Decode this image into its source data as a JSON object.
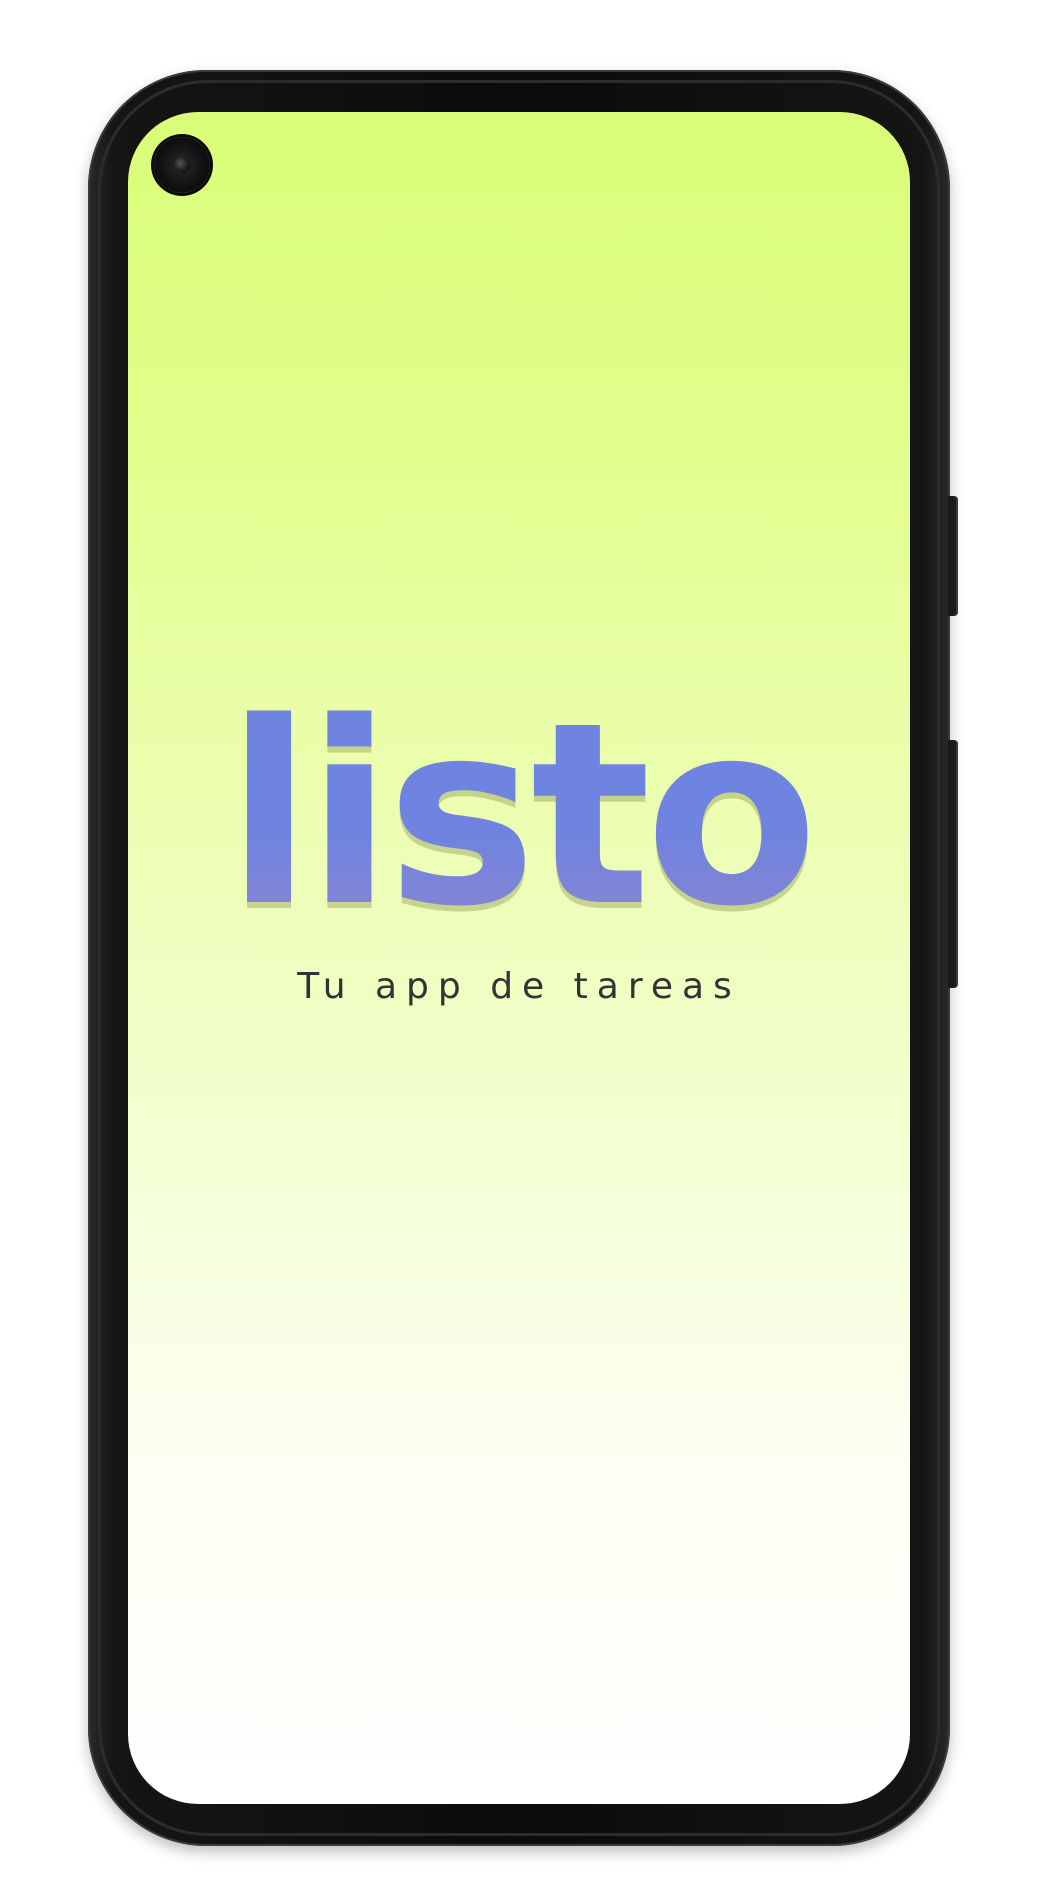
{
  "app": {
    "logo_text": "listo",
    "tagline": "Tu app de tareas"
  },
  "colors": {
    "logo": "#6f83e0",
    "screen_top": "#d9fd78",
    "screen_bottom": "#ffffff",
    "tagline": "#333333",
    "phone_frame": "#111111"
  },
  "icons": {
    "camera": "front-camera-icon"
  }
}
